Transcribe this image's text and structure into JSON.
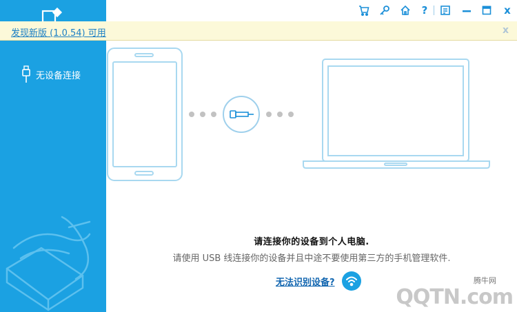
{
  "sidebar": {
    "device_status_label": "无设备连接",
    "icons": {
      "logo": "app-logo-icon",
      "usb": "usb-plug-icon"
    }
  },
  "titlebar": {
    "icons": [
      "shopping-cart-icon",
      "key-icon",
      "home-icon",
      "help-icon",
      "feedback-icon",
      "minimize-icon",
      "maximize-icon",
      "close-icon"
    ],
    "help_glyph": "?",
    "close_glyph": "x"
  },
  "notice": {
    "text": "发现新版 (1.0.54) 可用",
    "close_glyph": "x"
  },
  "main": {
    "title": "请连接你的设备到个人电脑.",
    "subtitle": "请使用 USB 线连接你的设备并且中途不要使用第三方的手机管理软件.",
    "help_link": "无法识别设备?"
  },
  "watermark": {
    "text": "腾牛网",
    "logo_text": "QQTN.com"
  },
  "colors": {
    "sidebar_bg": "#1ba1e2",
    "accent": "#1b8fd8",
    "notice_bg": "#fcf9d9",
    "illustration_line": "#a8d8f0"
  }
}
